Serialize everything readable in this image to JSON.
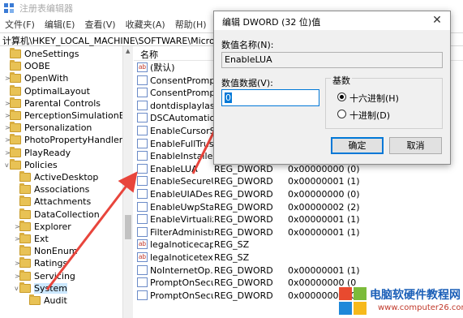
{
  "window": {
    "title": "注册表编辑器"
  },
  "menu": [
    "文件(F)",
    "编辑(E)",
    "查看(V)",
    "收藏夹(A)",
    "帮助(H)"
  ],
  "address": "计算机\\HKEY_LOCAL_MACHINE\\SOFTWARE\\Microsoft\\Windows",
  "tree": [
    {
      "label": "OneSettings",
      "expander": ""
    },
    {
      "label": "OOBE",
      "expander": ""
    },
    {
      "label": "OpenWith",
      "expander": ">"
    },
    {
      "label": "OptimalLayout",
      "expander": ""
    },
    {
      "label": "Parental Controls",
      "expander": ">"
    },
    {
      "label": "PerceptionSimulationExtensic",
      "expander": ">"
    },
    {
      "label": "Personalization",
      "expander": ">"
    },
    {
      "label": "PhotoPropertyHandler",
      "expander": ">"
    },
    {
      "label": "PlayReady",
      "expander": ">"
    },
    {
      "label": "Policies",
      "expander": "v"
    },
    {
      "label": "ActiveDesktop",
      "expander": ""
    },
    {
      "label": "Associations",
      "expander": ""
    },
    {
      "label": "Attachments",
      "expander": ""
    },
    {
      "label": "DataCollection",
      "expander": ""
    },
    {
      "label": "Explorer",
      "expander": ">"
    },
    {
      "label": "Ext",
      "expander": ">"
    },
    {
      "label": "NonEnum",
      "expander": ""
    },
    {
      "label": "Ratings",
      "expander": ">"
    },
    {
      "label": "Servicing",
      "expander": ">"
    },
    {
      "label": "System",
      "expander": "v"
    },
    {
      "label": "Audit",
      "expander": ""
    }
  ],
  "list": {
    "header": {
      "name": "名称"
    },
    "rows": [
      {
        "icon": "ab",
        "name": "(默认)",
        "type": "",
        "data": ""
      },
      {
        "icon": "dword",
        "name": "ConsentPromp...",
        "type": "",
        "data": ""
      },
      {
        "icon": "dword",
        "name": "ConsentPromp...",
        "type": "",
        "data": ""
      },
      {
        "icon": "dword",
        "name": "dontdisplaylas...",
        "type": "",
        "data": ""
      },
      {
        "icon": "dword",
        "name": "DSCAutomatio...",
        "type": "",
        "data": ""
      },
      {
        "icon": "dword",
        "name": "EnableCursorS...",
        "type": "",
        "data": ""
      },
      {
        "icon": "dword",
        "name": "EnableFullTrust...",
        "type": "",
        "data": ""
      },
      {
        "icon": "dword",
        "name": "EnableInstaller...",
        "type": "",
        "data": ""
      },
      {
        "icon": "dword",
        "name": "EnableLUA",
        "type": "REG_DWORD",
        "data": "0x00000000 (0)"
      },
      {
        "icon": "dword",
        "name": "EnableSecureU...",
        "type": "REG_DWORD",
        "data": "0x00000001 (1)"
      },
      {
        "icon": "dword",
        "name": "EnableUIADes...",
        "type": "REG_DWORD",
        "data": "0x00000000 (0)"
      },
      {
        "icon": "dword",
        "name": "EnableUwpSta...",
        "type": "REG_DWORD",
        "data": "0x00000002 (2)"
      },
      {
        "icon": "dword",
        "name": "EnableVirtualiz...",
        "type": "REG_DWORD",
        "data": "0x00000001 (1)"
      },
      {
        "icon": "dword",
        "name": "FilterAdministr...",
        "type": "REG_DWORD",
        "data": "0x00000001 (1)"
      },
      {
        "icon": "ab",
        "name": "legalnoticecap...",
        "type": "REG_SZ",
        "data": ""
      },
      {
        "icon": "ab",
        "name": "legalnoticetext",
        "type": "REG_SZ",
        "data": ""
      },
      {
        "icon": "dword",
        "name": "NoInternetOp...",
        "type": "REG_DWORD",
        "data": "0x00000001 (1)"
      },
      {
        "icon": "dword",
        "name": "PromptOnSecu...",
        "type": "REG_DWORD",
        "data": "0x00000000 (0"
      },
      {
        "icon": "dword",
        "name": "PromptOnSecu...",
        "type": "REG_DWORD",
        "data": "0x00000000 (0"
      }
    ]
  },
  "dialog": {
    "title": "编辑 DWORD (32 位)值",
    "close": "✕",
    "name_label": "数值名称(N):",
    "name_value": "EnableLUA",
    "data_label": "数值数据(V):",
    "data_value": "0",
    "base_label": "基数",
    "radio_hex": "十六进制(H)",
    "radio_dec": "十进制(D)",
    "ok": "确定",
    "cancel": "取消"
  },
  "watermark": {
    "title": "电脑软硬件教程网",
    "url": "www.computer26.com"
  },
  "colors": {
    "accent": "#0078d7",
    "arrow": "#e8453c",
    "folder": "#e8c255",
    "selection": "#cce8ff"
  }
}
